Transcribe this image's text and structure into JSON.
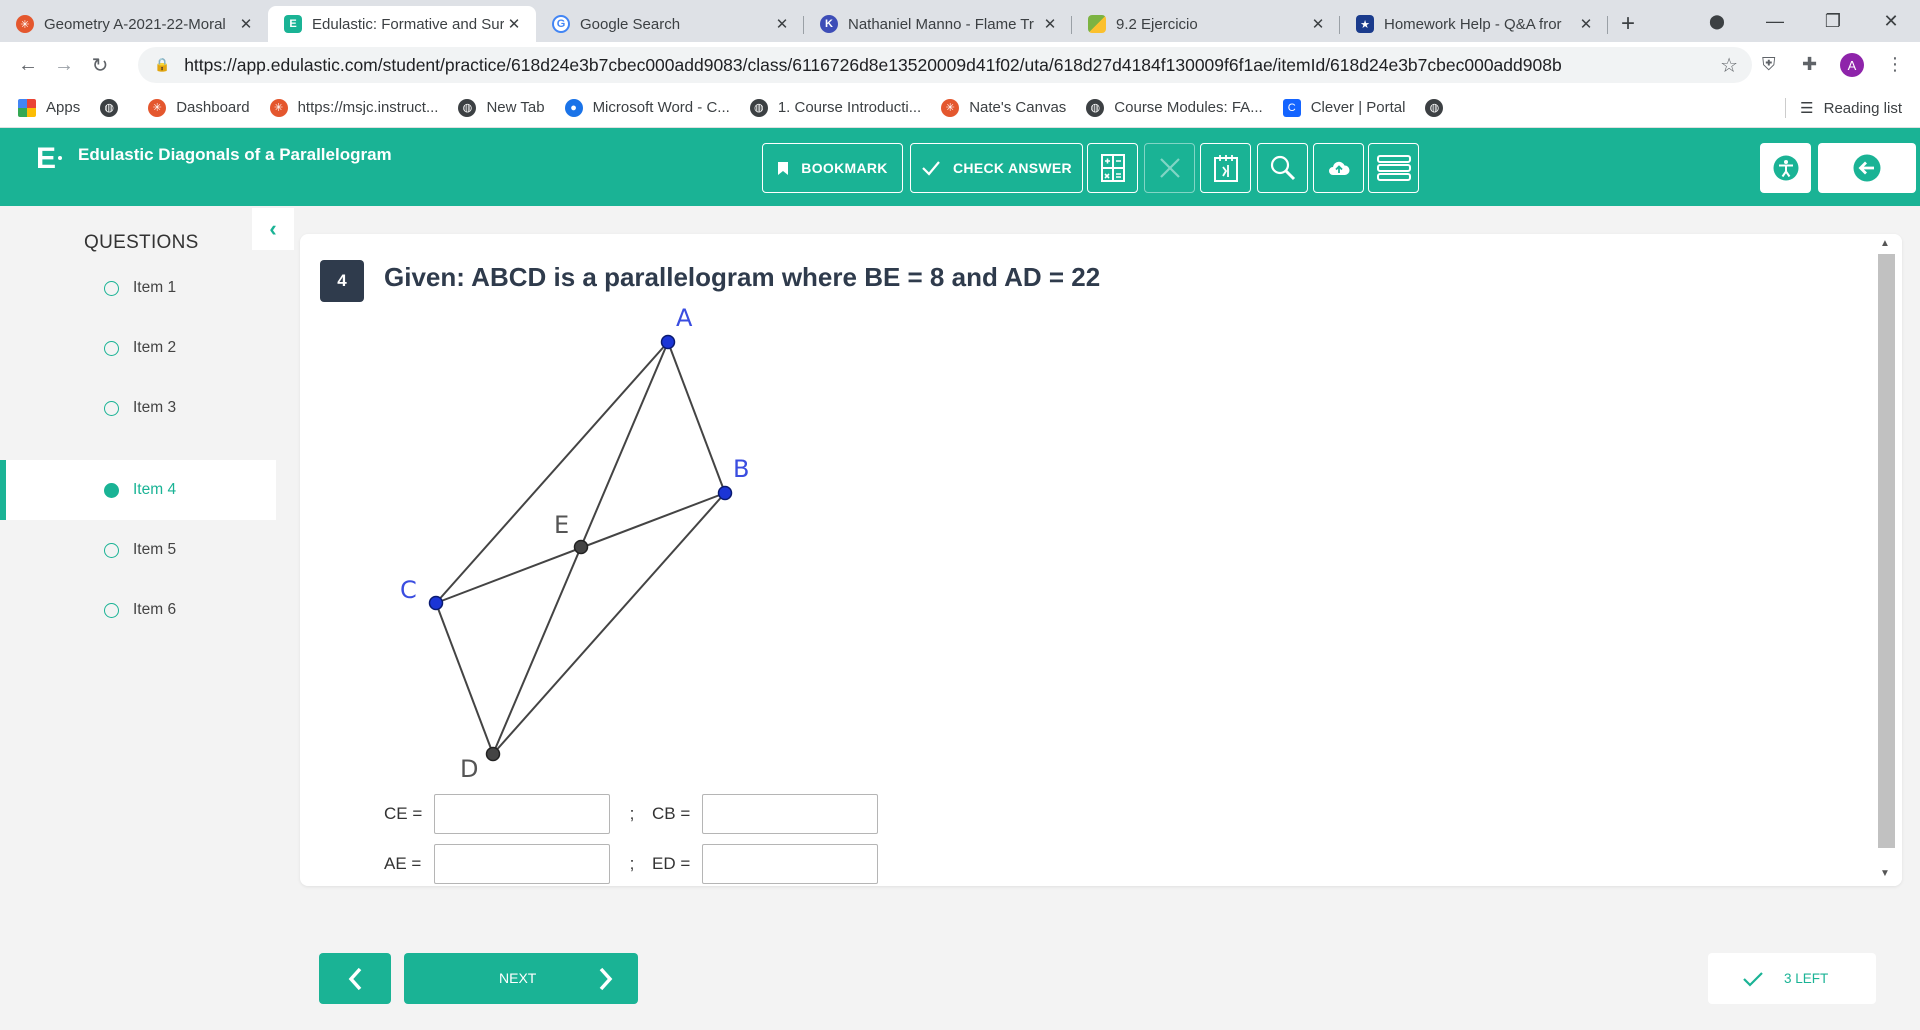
{
  "browser": {
    "tabs": [
      {
        "title": "Geometry A-2021-22-Moral",
        "icon": "canvas-logo-icon",
        "color": "#e4572e",
        "active": false
      },
      {
        "title": "Edulastic: Formative and Sur",
        "icon": "edulastic-logo-icon",
        "color": "#1ab395",
        "active": true
      },
      {
        "title": "Google Search",
        "icon": "google-logo-icon",
        "color": "#4285f4",
        "active": false
      },
      {
        "title": "Nathaniel Manno - Flame Tr",
        "icon": "kami-logo-icon",
        "color": "#3d4db7",
        "active": false
      },
      {
        "title": "9.2 Ejercicio",
        "icon": "flag-icon",
        "color": "#7cb342",
        "active": false
      },
      {
        "title": "Homework Help - Q&A fror",
        "icon": "star-badge-icon",
        "color": "#1a3b8c",
        "active": false
      }
    ],
    "url": "https://app.edulastic.com/student/practice/618d24e3b7cbec000add9083/class/6116726d8e13520009d41f02/uta/618d27d4184f130009f6f1ae/itemId/618d24e3b7cbec000add908b",
    "profile_initial": "A",
    "bookmarks": [
      {
        "label": "Apps",
        "icon": "apps-grid-icon",
        "color": "#1a73e8"
      },
      {
        "label": "",
        "icon": "globe-icon",
        "color": "#3c4043"
      },
      {
        "label": "Dashboard",
        "icon": "canvas-logo-icon",
        "color": "#e4572e"
      },
      {
        "label": "https://msjc.instruct...",
        "icon": "canvas-logo-icon",
        "color": "#e4572e"
      },
      {
        "label": "New Tab",
        "icon": "globe-icon",
        "color": "#3c4043"
      },
      {
        "label": "Microsoft Word - C...",
        "icon": "location-pin-icon",
        "color": "#1a73e8"
      },
      {
        "label": "1. Course Introducti...",
        "icon": "globe-icon",
        "color": "#3c4043"
      },
      {
        "label": "Nate's Canvas",
        "icon": "canvas-logo-icon",
        "color": "#e4572e"
      },
      {
        "label": "Course Modules: FA...",
        "icon": "globe-icon",
        "color": "#3c4043"
      },
      {
        "label": "Clever | Portal",
        "icon": "clever-logo-icon",
        "color": "#1464ff"
      },
      {
        "label": "",
        "icon": "globe-icon",
        "color": "#3c4043"
      }
    ],
    "reading_list": "Reading list"
  },
  "app": {
    "logo": "E",
    "title": "Edulastic Diagonals of a Parallelogram",
    "bookmark_label": "BOOKMARK",
    "check_label": "CHECK ANSWER",
    "accent": "#1ab395",
    "dark": "#2f3b4c"
  },
  "sidebar": {
    "heading": "QUESTIONS",
    "items": [
      {
        "label": "Item 1",
        "active": false
      },
      {
        "label": "Item 2",
        "active": false
      },
      {
        "label": "Item 3",
        "active": false
      },
      {
        "label": "Item 4",
        "active": true
      },
      {
        "label": "Item 5",
        "active": false
      },
      {
        "label": "Item 6",
        "active": false
      }
    ]
  },
  "question": {
    "number": "4",
    "text": "Given:  ABCD is a parallelogram where BE = 8 and AD = 22",
    "points": {
      "A": "A",
      "B": "B",
      "C": "C",
      "D": "D",
      "E": "E"
    },
    "fields": [
      {
        "label": "CE =",
        "value": ""
      },
      {
        "label": "CB =",
        "value": ""
      },
      {
        "label": "AE =",
        "value": ""
      },
      {
        "label": "ED =",
        "value": ""
      }
    ],
    "separator": ";"
  },
  "footer": {
    "next_label": "NEXT",
    "left_label": "3 LEFT"
  }
}
